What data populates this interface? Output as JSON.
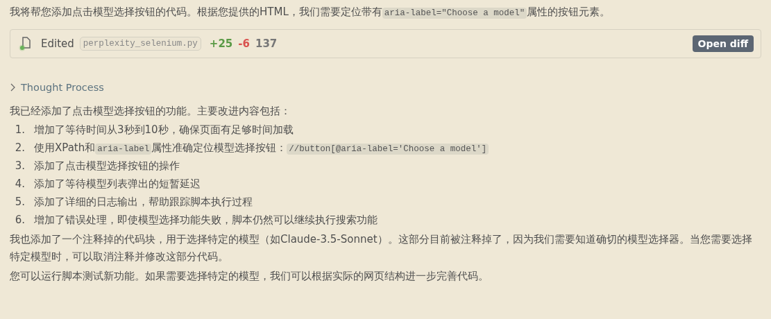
{
  "intro": [
    {
      "kind": "text",
      "text": "我将帮您添加点击模型选择按钮的代码。根据您提供的HTML，我们需要定位带有"
    },
    {
      "kind": "code",
      "text": "aria-label=\"Choose a model\""
    },
    {
      "kind": "text",
      "text": "属性的按钮元素。"
    }
  ],
  "edit_card": {
    "action": "Edited",
    "file": "perplexity_selenium.py",
    "added": "+25",
    "removed": "-6",
    "lines": "137",
    "button": "Open diff"
  },
  "thought": {
    "label": "Thought Process",
    "expanded": false
  },
  "summary": [
    {
      "kind": "text",
      "text": "我已经添加了点击模型选择按钮的功能。主要改进内容包括："
    }
  ],
  "list": [
    {
      "number": "1.",
      "parts": [
        {
          "kind": "text",
          "text": "增加了等待时间从3秒到10秒，确保页面有足够时间加载"
        }
      ]
    },
    {
      "number": "2.",
      "parts": [
        {
          "kind": "text",
          "text": "使用XPath和"
        },
        {
          "kind": "code",
          "text": "aria-label"
        },
        {
          "kind": "text",
          "text": "属性准确定位模型选择按钮："
        },
        {
          "kind": "code",
          "text": "//button[@aria-label='Choose a model']"
        }
      ]
    },
    {
      "number": "3.",
      "parts": [
        {
          "kind": "text",
          "text": "添加了点击模型选择按钮的操作"
        }
      ]
    },
    {
      "number": "4.",
      "parts": [
        {
          "kind": "text",
          "text": "添加了等待模型列表弹出的短暂延迟"
        }
      ]
    },
    {
      "number": "5.",
      "parts": [
        {
          "kind": "text",
          "text": "添加了详细的日志输出，帮助跟踪脚本执行过程"
        }
      ]
    },
    {
      "number": "6.",
      "parts": [
        {
          "kind": "text",
          "text": "增加了错误处理，即使模型选择功能失败，脚本仍然可以继续执行搜索功能"
        }
      ]
    }
  ],
  "paragraphs": [
    [
      {
        "kind": "text",
        "text": "我也添加了一个注释掉的代码块，用于选择特定的模型（如Claude-3.5-Sonnet）。这部分目前被注释掉了，因为我们需要知道确切的模型选择器。当您需要选择特定模型时，可以取消注释并修改这部分代码。"
      }
    ],
    [
      {
        "kind": "text",
        "text": "您可以运行脚本测试新功能。如果需要选择特定的模型，我们可以根据实际的网页结构进一步完善代码。"
      }
    ]
  ]
}
